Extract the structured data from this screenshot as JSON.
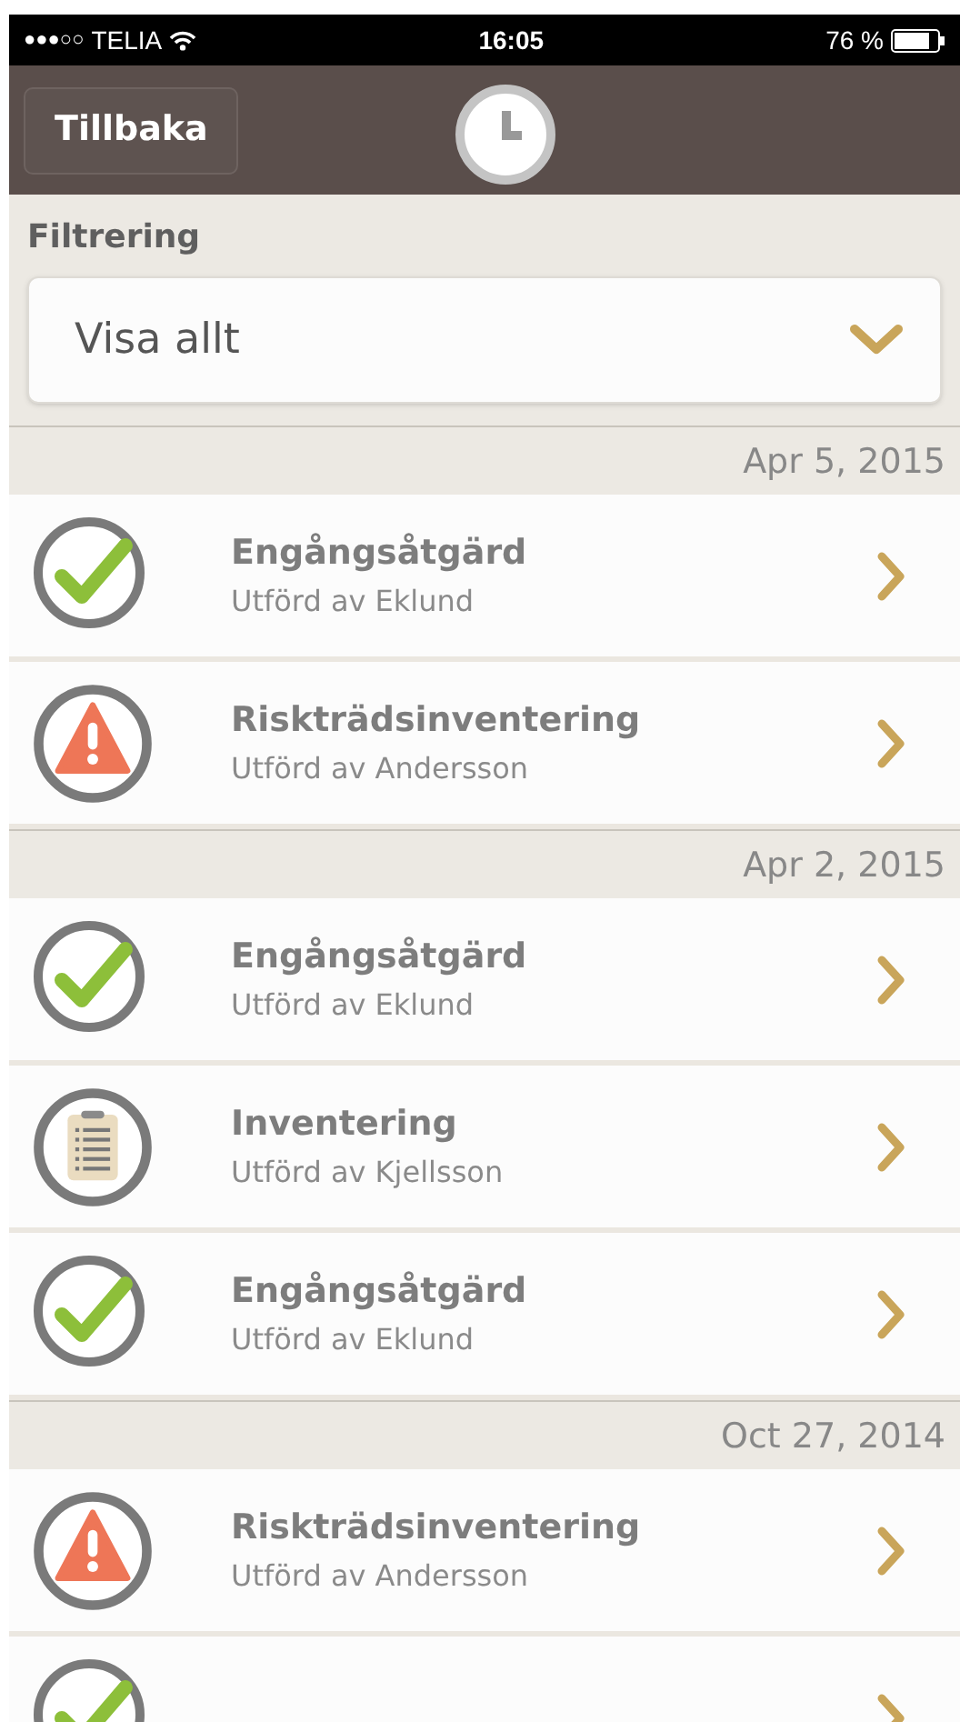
{
  "status_bar": {
    "signal": "●●●○○",
    "carrier": "TELIA",
    "time": "16:05",
    "battery": "76 %"
  },
  "nav": {
    "back": "Tillbaka"
  },
  "filter": {
    "label": "Filtrering",
    "value": "Visa allt"
  },
  "groups": [
    {
      "date": "Apr 5, 2015",
      "items": [
        {
          "kind": "done",
          "title": "Engångsåtgärd",
          "subtitle": "Utförd av Eklund"
        },
        {
          "kind": "warning",
          "title": "Riskträdsinventering",
          "subtitle": "Utförd av Andersson"
        }
      ]
    },
    {
      "date": "Apr 2, 2015",
      "items": [
        {
          "kind": "done",
          "title": "Engångsåtgärd",
          "subtitle": "Utförd av Eklund"
        },
        {
          "kind": "inventory",
          "title": "Inventering",
          "subtitle": "Utförd av Kjellsson"
        },
        {
          "kind": "done",
          "title": "Engångsåtgärd",
          "subtitle": "Utförd av Eklund"
        }
      ]
    },
    {
      "date": "Oct 27, 2014",
      "items": [
        {
          "kind": "warning",
          "title": "Riskträdsinventering",
          "subtitle": "Utförd av Andersson"
        },
        {
          "kind": "done"
        }
      ]
    }
  ]
}
